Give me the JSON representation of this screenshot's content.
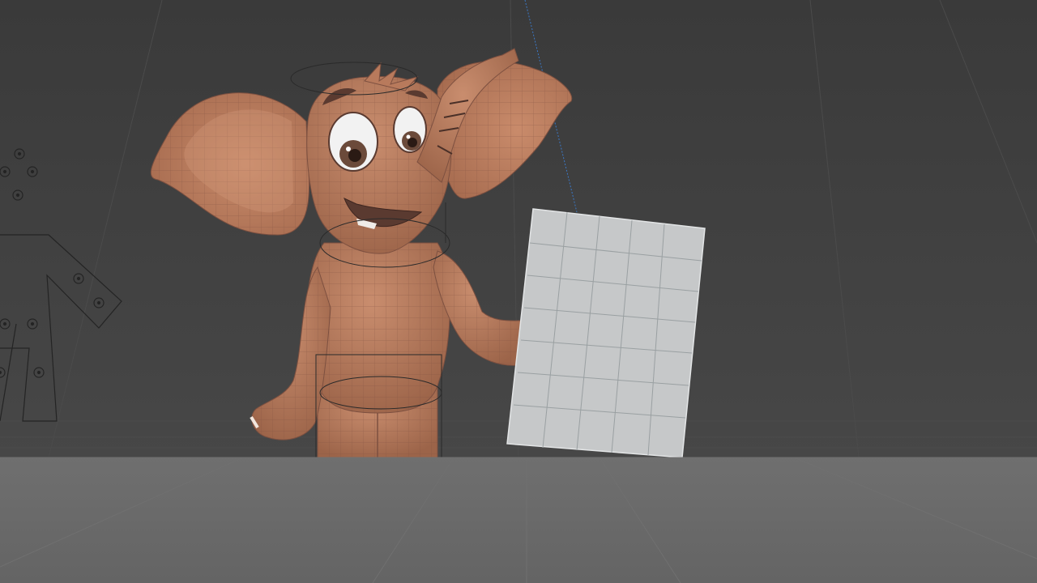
{
  "viewport": {
    "colors": {
      "background_top": "#3c3c3c",
      "background_bottom": "#444444",
      "floor": "#6a6a6a",
      "grid_line": "#4a4a4a",
      "rig_line": "#262626",
      "character_skin": "#b87a5c",
      "character_shadow": "#8c5a42",
      "character_wire": "#7d5040",
      "board_fill": "#c6c8c9",
      "board_wire": "#9aa0a2",
      "camera_line": "#3b78c6",
      "eye_white": "#f2f2f2",
      "iris": "#6b4a3a",
      "mouth": "#5a3a30"
    },
    "objects": {
      "character_icon": "elephant-character",
      "board_icon": "wireframe-board",
      "rig_icon": "armature-rig"
    }
  }
}
